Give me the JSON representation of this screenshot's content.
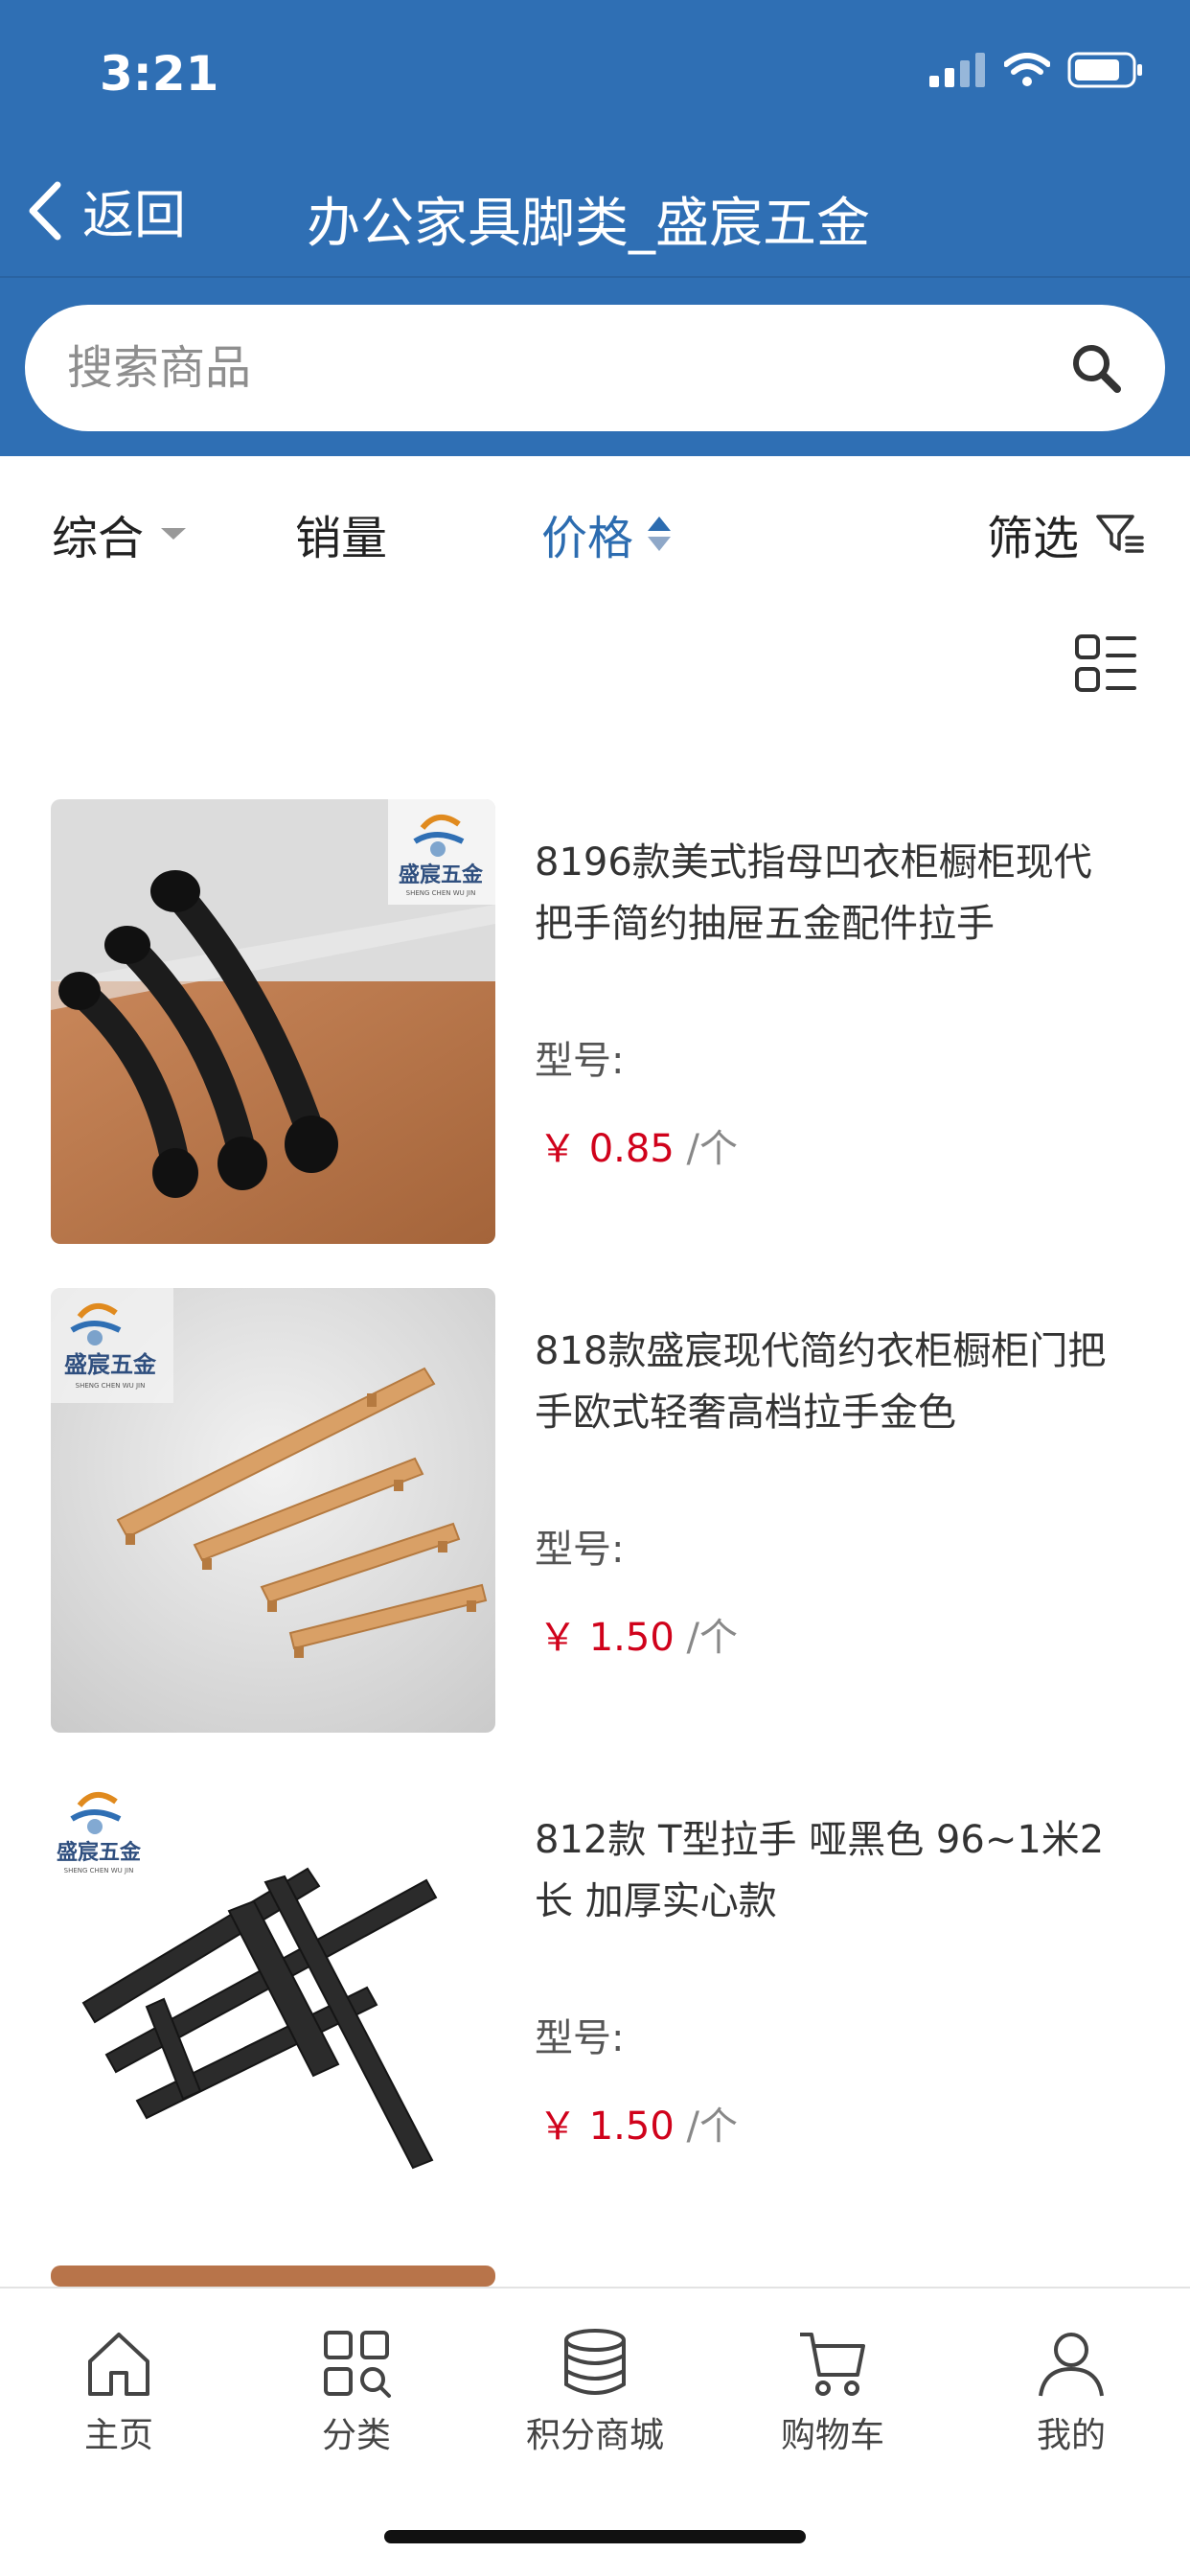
{
  "status": {
    "time": "3:21"
  },
  "nav": {
    "back_label": "返回",
    "title": "办公家具脚类_盛宸五金"
  },
  "search": {
    "placeholder": "搜索商品"
  },
  "sort": {
    "comprehensive": "综合",
    "sales": "销量",
    "price": "价格",
    "filter": "筛选",
    "active": "price"
  },
  "products": [
    {
      "name": "8196款美式指母凹衣柜橱柜现代把手简约抽屉五金配件拉手",
      "model_label": "型号:",
      "currency": "￥",
      "price": "0.85",
      "unit": "/个",
      "brand_logo": "盛宸五金",
      "brand_sub": "SHENG CHEN WU JIN",
      "image": "black-handles-on-wood"
    },
    {
      "name": "818款盛宸现代简约衣柜橱柜门把手欧式轻奢高档拉手金色",
      "model_label": "型号:",
      "currency": "￥",
      "price": "1.50",
      "unit": "/个",
      "brand_logo": "盛宸五金",
      "brand_sub": "SHENG CHEN WU JIN",
      "image": "gold-handles-on-grey"
    },
    {
      "name": "812款 T型拉手 哑黑色 96~1米2长 加厚实心款",
      "model_label": "型号:",
      "currency": "￥",
      "price": "1.50",
      "unit": "/个",
      "brand_logo": "盛宸五金",
      "brand_sub": "SHENG CHEN WU JIN",
      "image": "black-t-bars-on-white"
    }
  ],
  "tabbar": {
    "home": "主页",
    "category": "分类",
    "points_mall": "积分商城",
    "cart": "购物车",
    "mine": "我的"
  },
  "colors": {
    "brand_blue": "#2f6fb4",
    "active_sort": "#2c6cb0",
    "price_red": "#d0021b"
  }
}
